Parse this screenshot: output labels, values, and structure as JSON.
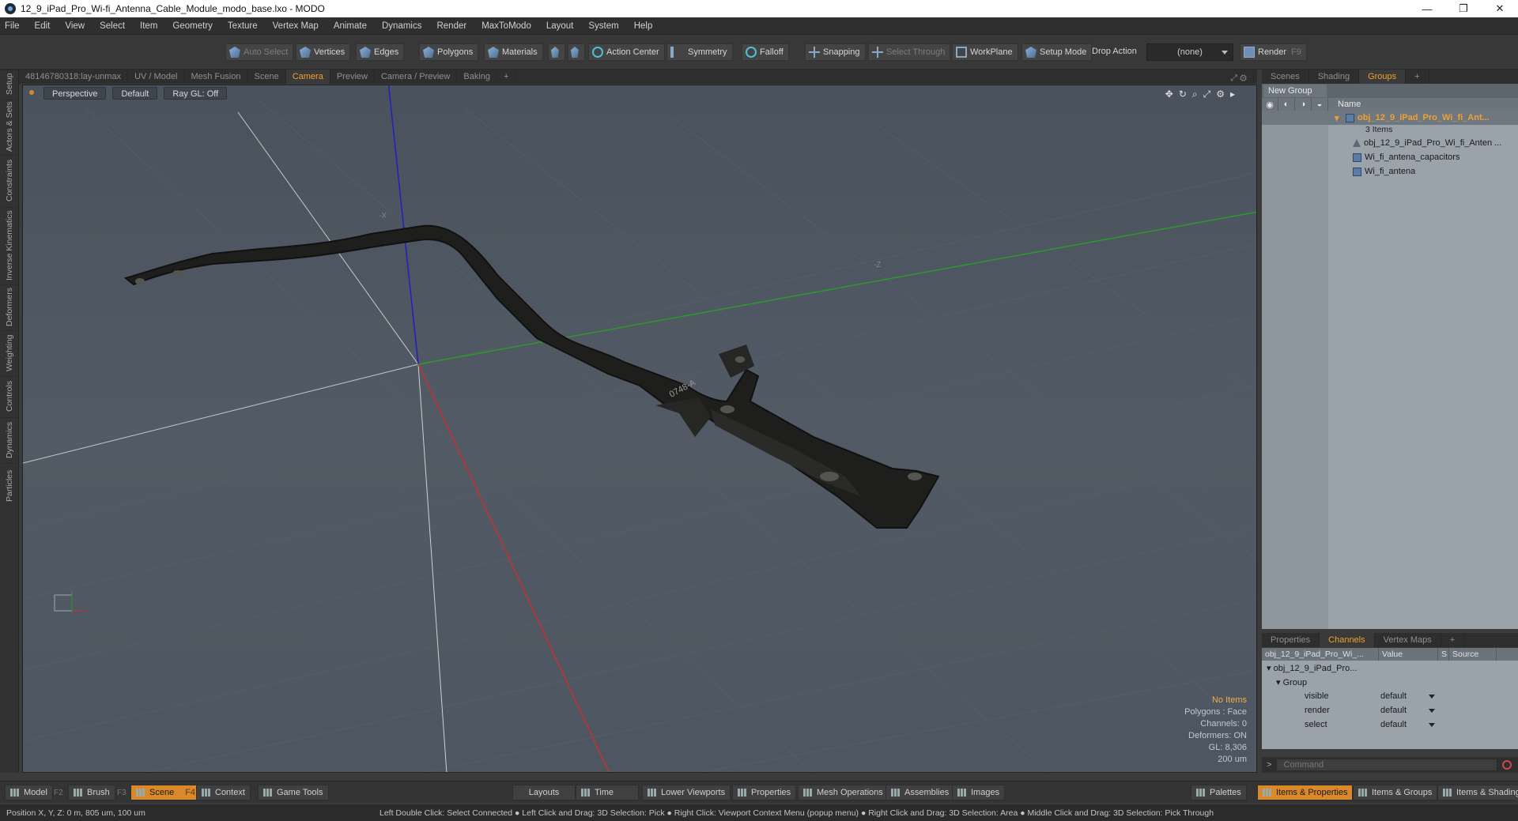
{
  "window": {
    "title": "12_9_iPad_Pro_Wi-fi_Antenna_Cable_Module_modo_base.lxo - MODO",
    "controls": [
      "—",
      "❐",
      "✕"
    ]
  },
  "menu": [
    "File",
    "Edit",
    "View",
    "Select",
    "Item",
    "Geometry",
    "Texture",
    "Vertex Map",
    "Animate",
    "Dynamics",
    "Render",
    "MaxToModo",
    "Layout",
    "System",
    "Help"
  ],
  "toolbar": {
    "auto_select": "Auto Select",
    "vertices": "Vertices",
    "edges": "Edges",
    "polygons": "Polygons",
    "materials": "Materials",
    "action_center": "Action Center",
    "symmetry": "Symmetry",
    "falloff": "Falloff",
    "snapping": "Snapping",
    "select_through": "Select Through",
    "workplane": "WorkPlane",
    "setup_mode": "Setup Mode",
    "drop_action_label": "Drop Action",
    "drop_action_value": "(none)",
    "render": "Render",
    "render_key": "F9"
  },
  "left_tabs": [
    "Setup",
    "Actors & Sets",
    "Constraints",
    "Inverse Kinematics",
    "Deformers",
    "Weighting",
    "Controls",
    "Dynamics",
    "Particles"
  ],
  "viewport_tabs": [
    "48146780318:lay-unmax",
    "UV / Model",
    "Mesh Fusion",
    "Scene",
    "Camera",
    "Preview",
    "Camera / Preview",
    "Baking",
    "+"
  ],
  "viewport_tabs_active": "Camera",
  "viewport": {
    "perspective": "Perspective",
    "shading": "Default",
    "raygl": "Ray GL: Off",
    "axis_x_label": "-X",
    "axis_z_label": "-Z",
    "cable_text": "0748-A",
    "info": {
      "no_items": "No Items",
      "polygons": "Polygons : Face",
      "channels": "Channels: 0",
      "deformers": "Deformers: ON",
      "gl": "GL: 8,306",
      "scale": "200 um"
    }
  },
  "right_tabs": [
    "Scenes",
    "Shading",
    "Groups",
    "+"
  ],
  "right_tabs_active": "Groups",
  "groups": {
    "new_group": "New Group",
    "name_header": "Name",
    "root": "obj_12_9_iPad_Pro_Wi_fi_Ant...",
    "root_count": "3 Items",
    "items": [
      "obj_12_9_iPad_Pro_Wi_fi_Anten ...",
      "Wi_fi_antena_capacitors",
      "Wi_fi_antena"
    ]
  },
  "channel_tabs": [
    "Properties",
    "Channels",
    "Vertex Maps",
    "+"
  ],
  "channel_tabs_active": "Channels",
  "channels": {
    "headers": [
      "obj_12_9_iPad_Pro_Wi_...",
      "Value",
      "S",
      "Source"
    ],
    "root": "obj_12_9_iPad_Pro...",
    "group": "Group",
    "rows": [
      {
        "name": "visible",
        "value": "default"
      },
      {
        "name": "render",
        "value": "default"
      },
      {
        "name": "select",
        "value": "default"
      }
    ]
  },
  "command": {
    "prompt": ">",
    "placeholder": "Command"
  },
  "bottom": {
    "model": "Model",
    "model_key": "F2",
    "brush": "Brush",
    "brush_key": "F3",
    "scene": "Scene",
    "scene_key": "F4",
    "context": "Context",
    "game_tools": "Game Tools",
    "layouts": "Layouts",
    "time": "Time",
    "lower_viewports": "Lower Viewports",
    "properties": "Properties",
    "mesh_operations": "Mesh Operations",
    "assemblies": "Assemblies",
    "images": "Images",
    "palettes": "Palettes",
    "items_properties": "Items & Properties",
    "items_groups": "Items & Groups",
    "items_shading": "Items & Shading"
  },
  "status": {
    "position": "Position X, Y, Z:   0 m, 805 um, 100 um",
    "hints": "Left Double Click: Select Connected ● Left Click and Drag: 3D Selection: Pick ● Right Click: Viewport Context Menu (popup menu) ● Right Click and Drag: 3D Selection: Area ● Middle Click and Drag: 3D Selection: Pick Through"
  },
  "colors": {
    "accent": "#f0a030",
    "axis_x": "#c83030",
    "axis_y": "#2a9a2a",
    "axis_z": "#2020c0"
  }
}
